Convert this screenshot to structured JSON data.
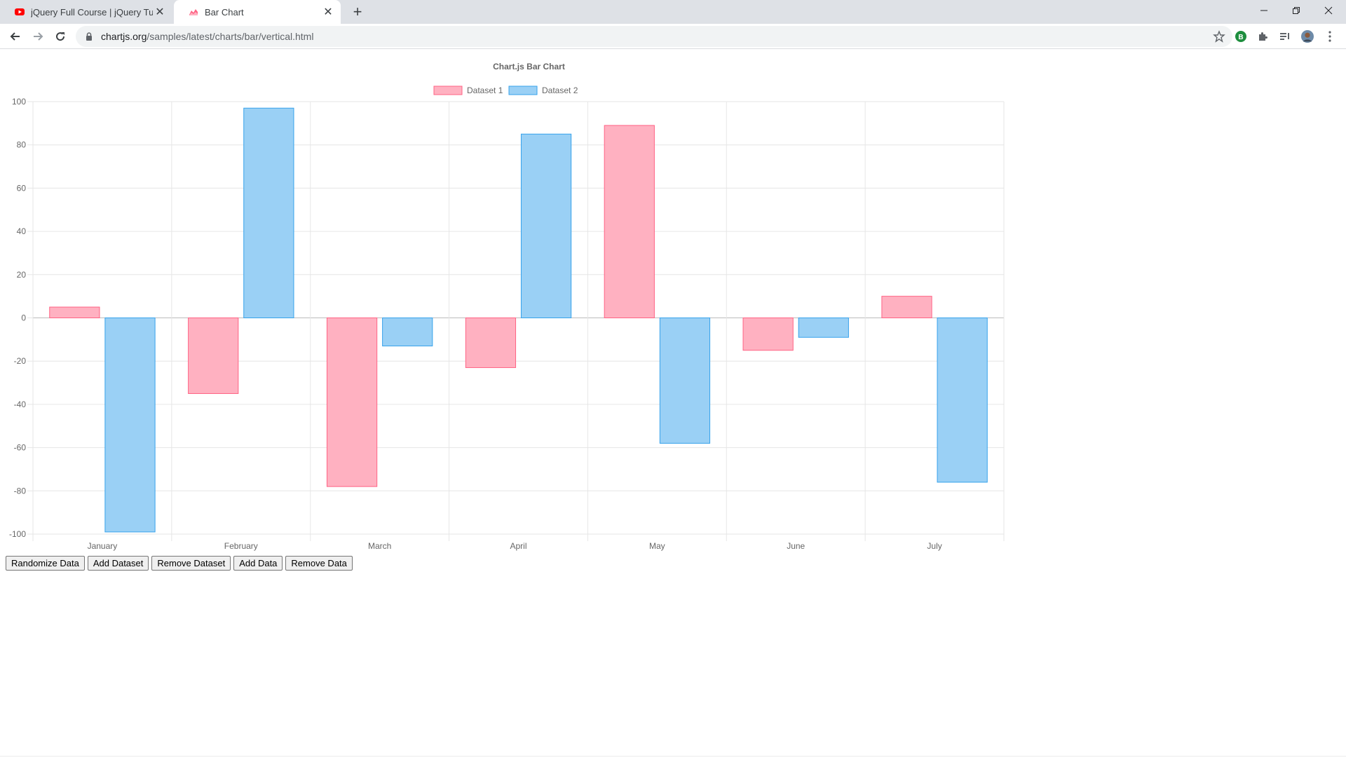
{
  "browser": {
    "tabs": [
      {
        "title": "jQuery Full Course | jQuery Tutor",
        "active": false,
        "favicon": "youtube-icon"
      },
      {
        "title": "Bar Chart",
        "active": true,
        "favicon": "chartjs-icon"
      }
    ],
    "url_host": "chartjs.org",
    "url_path": "/samples/latest/charts/bar/vertical.html",
    "accent": "#1a73e8"
  },
  "chart_data": {
    "type": "bar",
    "title": "Chart.js Bar Chart",
    "categories": [
      "January",
      "February",
      "March",
      "April",
      "May",
      "June",
      "July"
    ],
    "series": [
      {
        "name": "Dataset 1",
        "values": [
          5,
          -35,
          -78,
          -23,
          89,
          -15,
          10
        ],
        "fill": "#ffb1c1",
        "stroke": "#ff6384"
      },
      {
        "name": "Dataset 2",
        "values": [
          -99,
          97,
          -13,
          85,
          -58,
          -9,
          -76
        ],
        "fill": "#9ad0f5",
        "stroke": "#36a2eb"
      }
    ],
    "yticks": [
      100,
      80,
      60,
      40,
      20,
      0,
      -20,
      -40,
      -60,
      -80,
      -100
    ],
    "ylim": [
      -100,
      100
    ],
    "grid": true,
    "legend": "top"
  },
  "controls": {
    "randomize": "Randomize Data",
    "add_dataset": "Add Dataset",
    "remove_dataset": "Remove Dataset",
    "add_data": "Add Data",
    "remove_data": "Remove Data"
  }
}
